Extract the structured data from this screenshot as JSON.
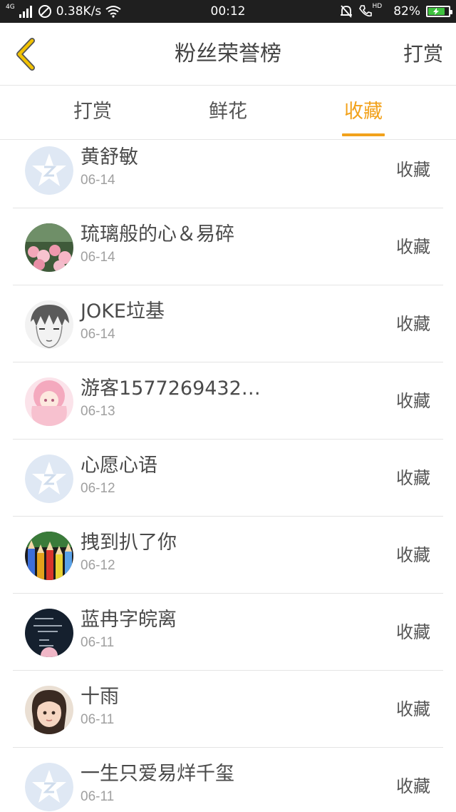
{
  "status_bar": {
    "network_type": "4G",
    "speed": "0.38K/s",
    "time": "00:12",
    "hd_label": "HD",
    "battery": "82%",
    "battery_level": 0.82,
    "battery_color": "#3fc23f"
  },
  "nav": {
    "title": "粉丝荣誉榜",
    "action_label": "打赏",
    "back_icon": "chevron-left-icon",
    "accent_color": "#f2c200"
  },
  "tabs": {
    "items": [
      {
        "label": "打赏"
      },
      {
        "label": "鲜花"
      },
      {
        "label": "收藏"
      }
    ],
    "active_index": 2,
    "active_color": "#f2a21c"
  },
  "list": {
    "items": [
      {
        "name": "黄舒敏",
        "date": "06-14",
        "type": "收藏",
        "avatar": "default-avatar"
      },
      {
        "name": "琉璃般的心＆易碎",
        "date": "06-14",
        "type": "收藏",
        "avatar": "flowers-photo-avatar"
      },
      {
        "name": "JOKE垃基",
        "date": "06-14",
        "type": "收藏",
        "avatar": "anime-sketch-avatar"
      },
      {
        "name": "游客1577269432…",
        "date": "06-13",
        "type": "收藏",
        "avatar": "pink-anime-avatar"
      },
      {
        "name": "心愿心语",
        "date": "06-12",
        "type": "收藏",
        "avatar": "default-avatar"
      },
      {
        "name": "拽到扒了你",
        "date": "06-12",
        "type": "收藏",
        "avatar": "colored-pencils-avatar"
      },
      {
        "name": "蓝冉字皖离",
        "date": "06-11",
        "type": "收藏",
        "avatar": "dark-chalkboard-avatar"
      },
      {
        "name": "十雨",
        "date": "06-11",
        "type": "收藏",
        "avatar": "child-photo-avatar"
      },
      {
        "name": "一生只爱易烊千玺",
        "date": "06-11",
        "type": "收藏",
        "avatar": "default-avatar"
      }
    ]
  }
}
